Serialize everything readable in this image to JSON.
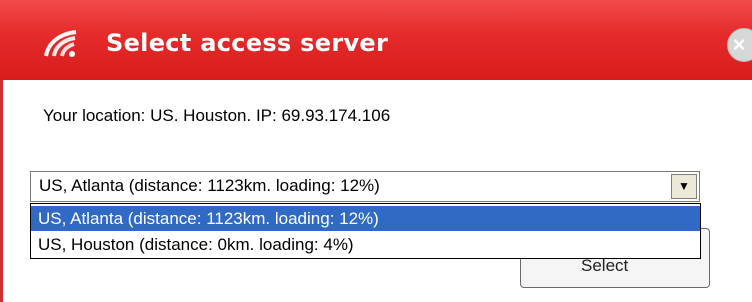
{
  "dialog": {
    "title": "Select access server",
    "close_icon": "close-icon",
    "app_icon": "wifi-signal-icon",
    "location_text": "Your location: US. Houston.  IP: 69.93.174.106",
    "selected_server": "US, Atlanta (distance: 1123km. loading: 12%)",
    "options": [
      "US, Atlanta (distance: 1123km. loading: 12%)",
      "US, Houston (distance: 0km. loading: 4%)"
    ],
    "select_button": "Select"
  },
  "colors": {
    "titlebar": "#e42a2a",
    "highlight": "#316ac5"
  }
}
